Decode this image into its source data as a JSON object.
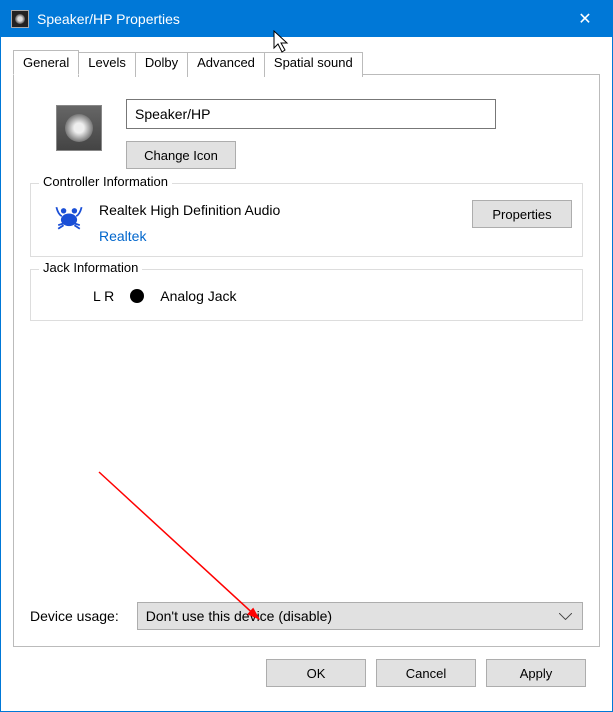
{
  "title": "Speaker/HP Properties",
  "tabs": [
    "General",
    "Levels",
    "Dolby",
    "Advanced",
    "Spatial sound"
  ],
  "activeTab": 0,
  "deviceName": "Speaker/HP",
  "changeIcon": "Change Icon",
  "controllerLegend": "Controller Information",
  "controllerName": "Realtek High Definition Audio",
  "controllerVendor": "Realtek",
  "propertiesBtn": "Properties",
  "jackLegend": "Jack Information",
  "jackChannels": "L R",
  "jackType": "Analog Jack",
  "usageLabel": "Device usage:",
  "usageValue": "Don't use this device (disable)",
  "buttons": {
    "ok": "OK",
    "cancel": "Cancel",
    "apply": "Apply"
  }
}
